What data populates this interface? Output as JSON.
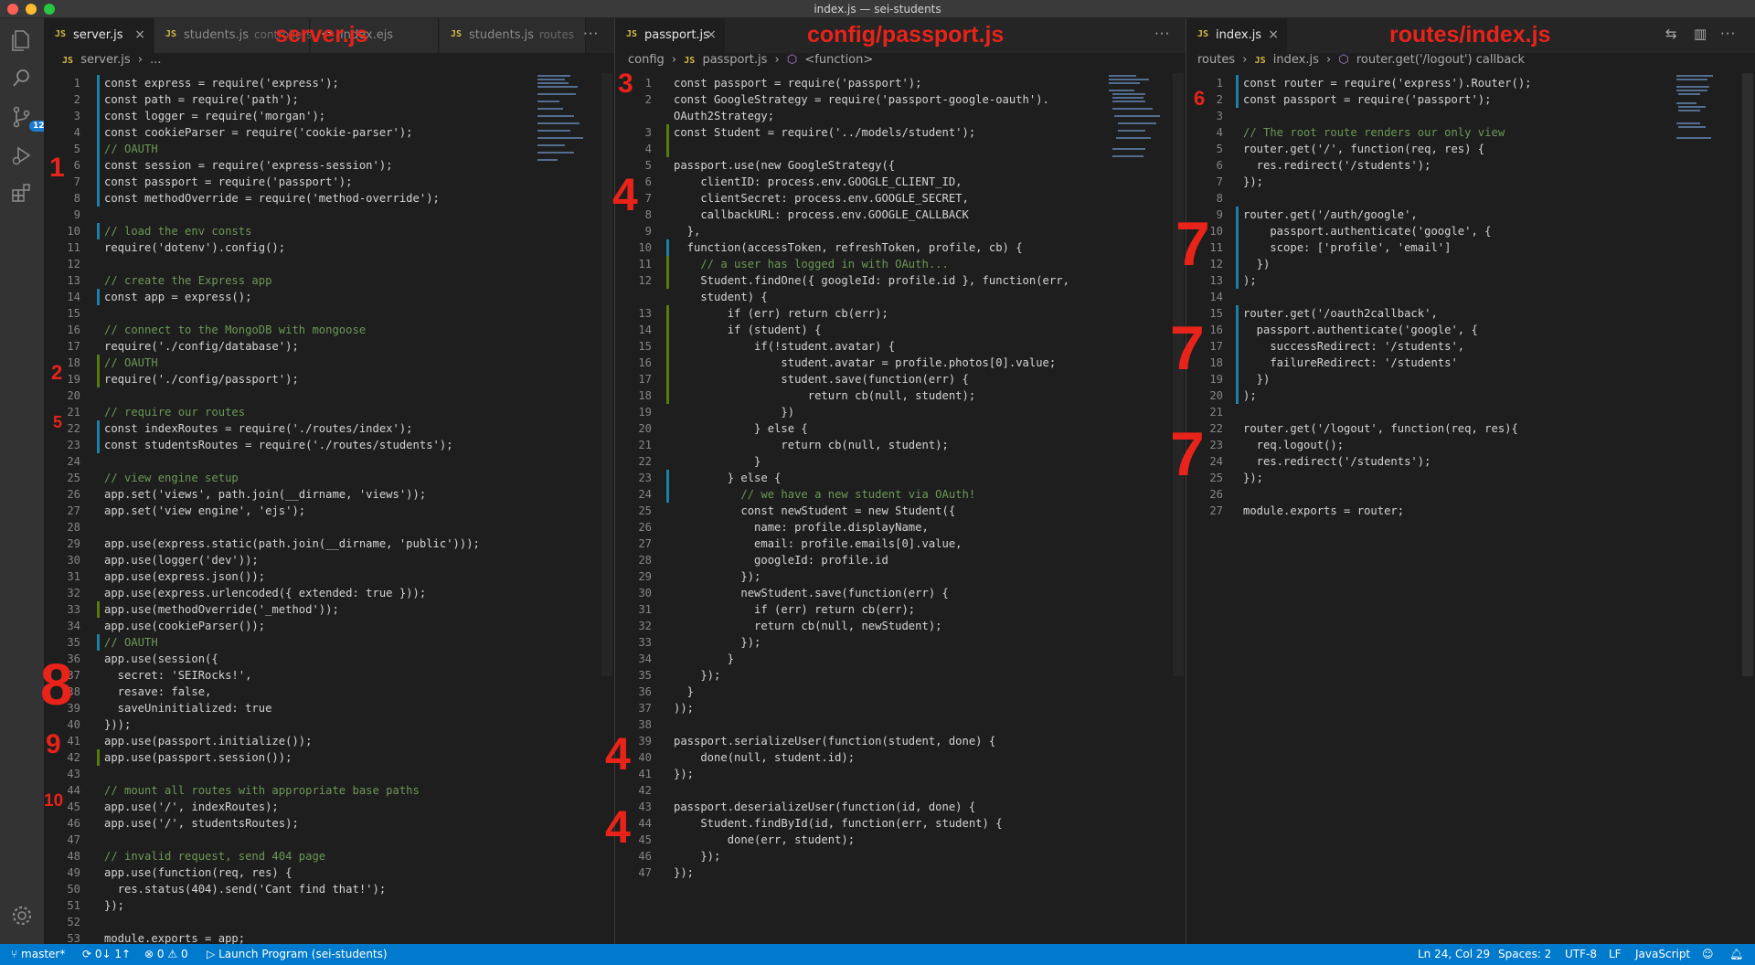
{
  "window": {
    "title": "index.js — sei-students"
  },
  "activity_bar": {
    "badge": "12",
    "icons": [
      "files-icon",
      "search-icon",
      "source-control-icon",
      "run-debug-icon",
      "extensions-icon",
      "settings-gear-icon"
    ]
  },
  "panes": [
    {
      "label": "server.js",
      "tabs": [
        {
          "name": "server.js",
          "desc": ""
        },
        {
          "name": "students.js",
          "desc": "controllers"
        },
        {
          "name": "index.ejs",
          "desc": ""
        },
        {
          "name": "students.js",
          "desc": "routes"
        }
      ],
      "breadcrumb": [
        "server.js",
        "..."
      ],
      "lines": [
        "const express = require('express');",
        "const path = require('path');",
        "const logger = require('morgan');",
        "const cookieParser = require('cookie-parser');",
        "// OAUTH",
        "const session = require('express-session');",
        "const passport = require('passport');",
        "const methodOverride = require('method-override');",
        "",
        "// load the env consts",
        "require('dotenv').config();",
        "",
        "// create the Express app",
        "const app = express();",
        "",
        "// connect to the MongoDB with mongoose",
        "require('./config/database');",
        "// OAUTH",
        "require('./config/passport');",
        "",
        "// require our routes",
        "const indexRoutes = require('./routes/index');",
        "const studentsRoutes = require('./routes/students');",
        "",
        "// view engine setup",
        "app.set('views', path.join(__dirname, 'views'));",
        "app.set('view engine', 'ejs');",
        "",
        "app.use(express.static(path.join(__dirname, 'public')));",
        "app.use(logger('dev'));",
        "app.use(express.json());",
        "app.use(express.urlencoded({ extended: true }));",
        "app.use(methodOverride('_method'));",
        "app.use(cookieParser());",
        "// OAUTH",
        "app.use(session({",
        "  secret: 'SEIRocks!',",
        "  resave: false,",
        "  saveUninitialized: true",
        "}));",
        "app.use(passport.initialize());",
        "app.use(passport.session());",
        "",
        "// mount all routes with appropriate base paths",
        "app.use('/', indexRoutes);",
        "app.use('/', studentsRoutes);",
        "",
        "// invalid request, send 404 page",
        "app.use(function(req, res) {",
        "  res.status(404).send('Cant find that!');",
        "});",
        "",
        "module.exports = app;"
      ],
      "annotations": [
        "1",
        "2",
        "5",
        "8",
        "9",
        "10"
      ]
    },
    {
      "label": "config/passport.js",
      "tabs": [
        {
          "name": "passport.js",
          "desc": ""
        }
      ],
      "breadcrumb": [
        "config",
        "passport.js",
        "<function>"
      ],
      "lines": [
        "const passport = require('passport');",
        "const GoogleStrategy = require('passport-google-oauth').",
        "OAuth2Strategy;",
        "const Student = require('../models/student');",
        "",
        "passport.use(new GoogleStrategy({",
        "    clientID: process.env.GOOGLE_CLIENT_ID,",
        "    clientSecret: process.env.GOOGLE_SECRET,",
        "    callbackURL: process.env.GOOGLE_CALLBACK",
        "  },",
        "  function(accessToken, refreshToken, profile, cb) {",
        "    // a user has logged in with OAuth...",
        "    Student.findOne({ googleId: profile.id }, function(err,",
        "    student) {",
        "        if (err) return cb(err);",
        "        if (student) {",
        "            if(!student.avatar) {",
        "                student.avatar = profile.photos[0].value;",
        "                student.save(function(err) {",
        "                    return cb(null, student);",
        "                })",
        "            } else {",
        "                return cb(null, student);",
        "            }",
        "        } else {",
        "          // we have a new student via OAuth!",
        "          const newStudent = new Student({",
        "            name: profile.displayName,",
        "            email: profile.emails[0].value,",
        "            googleId: profile.id",
        "          });",
        "          newStudent.save(function(err) {",
        "            if (err) return cb(err);",
        "            return cb(null, newStudent);",
        "          });",
        "        }",
        "    });",
        "  }",
        "));",
        "",
        "passport.serializeUser(function(student, done) {",
        "    done(null, student.id);",
        "});",
        "",
        "passport.deserializeUser(function(id, done) {",
        "    Student.findById(id, function(err, student) {",
        "        done(err, student);",
        "    });",
        "});"
      ],
      "line_numbers": [
        "1",
        "2",
        "",
        "3",
        "4",
        "5",
        "6",
        "7",
        "8",
        "9",
        "10",
        "11",
        "12",
        "",
        "13",
        "14",
        "15",
        "16",
        "17",
        "18",
        "19",
        "20",
        "21",
        "22",
        "23",
        "24",
        "25",
        "26",
        "27",
        "28",
        "29",
        "30",
        "31",
        "32",
        "33",
        "34",
        "35",
        "36",
        "37",
        "38",
        "39",
        "40",
        "41",
        "42",
        "43",
        "44",
        "45",
        "46",
        "47"
      ],
      "annotations": [
        "3",
        "4",
        "4",
        "4"
      ]
    },
    {
      "label": "routes/index.js",
      "tabs": [
        {
          "name": "index.js",
          "desc": ""
        }
      ],
      "breadcrumb": [
        "routes",
        "index.js",
        "router.get('/logout') callback"
      ],
      "lines": [
        "const router = require('express').Router();",
        "const passport = require('passport');",
        "",
        "// The root route renders our only view",
        "router.get('/', function(req, res) {",
        "  res.redirect('/students');",
        "});",
        "",
        "router.get('/auth/google',",
        "    passport.authenticate('google', {",
        "    scope: ['profile', 'email']",
        "  })",
        ");",
        "",
        "router.get('/oauth2callback',",
        "  passport.authenticate('google', {",
        "    successRedirect: '/students',",
        "    failureRedirect: '/students'",
        "  })",
        ");",
        "",
        "router.get('/logout', function(req, res){",
        "  req.logout();",
        "  res.redirect('/students');",
        "});",
        "",
        "module.exports = router;"
      ],
      "annotations": [
        "6",
        "7",
        "7",
        "7"
      ]
    }
  ],
  "status_bar": {
    "branch": "master*",
    "sync": "0↓ 1↑",
    "problems": "0",
    "warnings": "0",
    "launch": "Launch Program (sei-students)",
    "position": "Ln 24, Col 29",
    "spaces": "Spaces: 2",
    "encoding": "UTF-8",
    "eol": "LF",
    "language": "JavaScript"
  }
}
